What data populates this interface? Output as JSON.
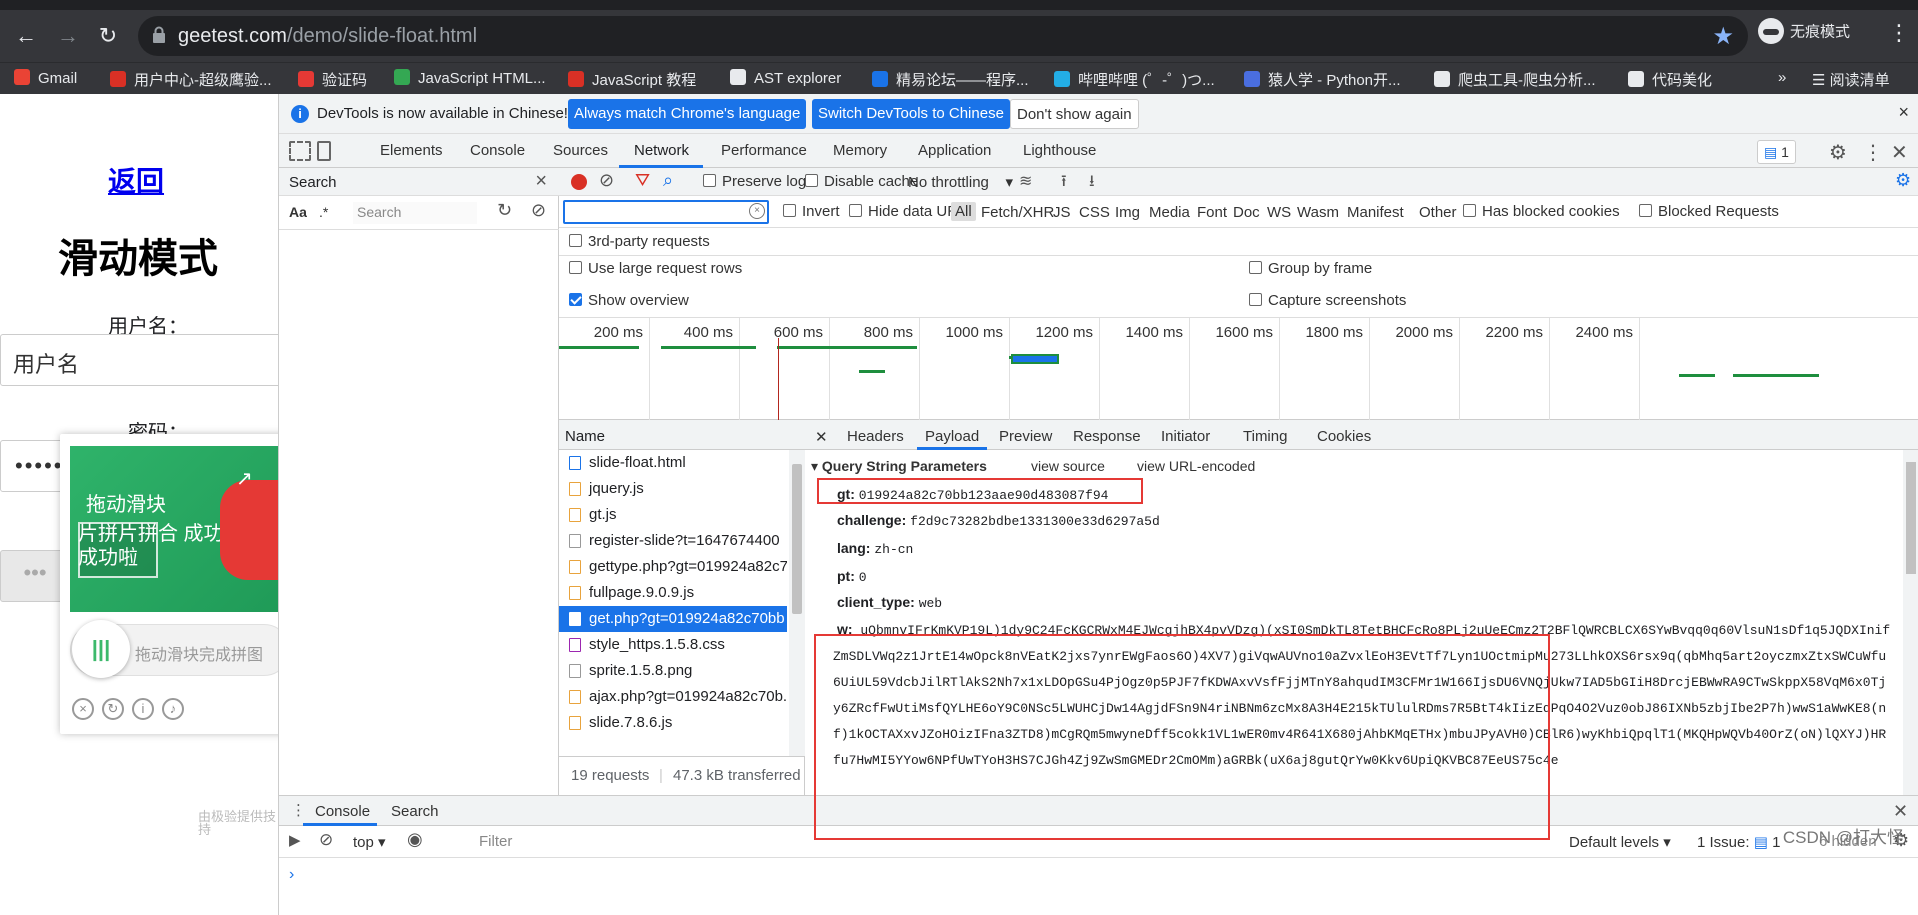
{
  "browser": {
    "url_host": "geetest.com",
    "url_path": "/demo/slide-float.html",
    "incognito_label": "无痕模式",
    "bookmarks": [
      {
        "label": "Gmail",
        "color": "#ea4335"
      },
      {
        "label": "用户中心-超级鹰验...",
        "color": "#d93025"
      },
      {
        "label": "验证码",
        "color": "#e53935"
      },
      {
        "label": "JavaScript HTML...",
        "color": "#34a853"
      },
      {
        "label": "JavaScript 教程",
        "color": "#d93025"
      },
      {
        "label": "AST explorer",
        "color": "#e8eaed"
      },
      {
        "label": "精易论坛——程序...",
        "color": "#1a73e8"
      },
      {
        "label": "哔哩哔哩 (゜-゜)つ...",
        "color": "#23ade5"
      },
      {
        "label": "猿人学 - Python开...",
        "color": "#4a6ee0"
      },
      {
        "label": "爬虫工具-爬虫分析...",
        "color": "#e8eaed"
      },
      {
        "label": "代码美化",
        "color": "#e8eaed"
      }
    ],
    "more_label": "»",
    "reading_list": "阅读清单"
  },
  "page": {
    "back_link": "返回",
    "title": "滑动模式",
    "username_label": "用户名：",
    "username_value": "用户名",
    "password_label": "密码：",
    "password_value": "••••••",
    "button_dots": "•••",
    "captcha": {
      "hint_line1": "拖动滑块",
      "hint_line2": "片拼片拼合 成功 成功啦",
      "slider_text": "拖动滑块完成拼图",
      "footer": "由极验提供技持"
    }
  },
  "devtools": {
    "info_message": "DevTools is now available in Chinese!",
    "btn_match": "Always match Chrome's language",
    "btn_switch": "Switch DevTools to Chinese",
    "btn_dont_show": "Don't show again",
    "panels": [
      "Elements",
      "Console",
      "Sources",
      "Network",
      "Performance",
      "Memory",
      "Application",
      "Lighthouse"
    ],
    "messages_count": "1",
    "search_title": "Search",
    "search_aa": "Aa",
    "search_regex": ".*",
    "search_placeholder": "Search",
    "network": {
      "preserve_log": "Preserve log",
      "disable_cache": "Disable cache",
      "throttling": "No throttling",
      "invert": "Invert",
      "hide_data_urls": "Hide data URLs",
      "types": [
        "All",
        "Fetch/XHR",
        "JS",
        "CSS",
        "Img",
        "Media",
        "Font",
        "Doc",
        "WS",
        "Wasm",
        "Manifest",
        "Other"
      ],
      "has_blocked_cookies": "Has blocked cookies",
      "blocked_requests": "Blocked Requests",
      "third_party": "3rd-party requests",
      "large_rows": "Use large request rows",
      "group_by_frame": "Group by frame",
      "show_overview": "Show overview",
      "capture_screenshots": "Capture screenshots",
      "timeline_ticks": [
        "200 ms",
        "400 ms",
        "600 ms",
        "800 ms",
        "1000 ms",
        "1200 ms",
        "1400 ms",
        "1600 ms",
        "1800 ms",
        "2000 ms",
        "2200 ms",
        "2400 ms"
      ],
      "name_header": "Name",
      "requests": [
        {
          "name": "slide-float.html",
          "type": "doc"
        },
        {
          "name": "jquery.js",
          "type": "js"
        },
        {
          "name": "gt.js",
          "type": "js"
        },
        {
          "name": "register-slide?t=1647674400",
          "type": "img"
        },
        {
          "name": "gettype.php?gt=019924a82c7",
          "type": "js"
        },
        {
          "name": "fullpage.9.0.9.js",
          "type": "js"
        },
        {
          "name": "get.php?gt=019924a82c70bb",
          "type": "js",
          "selected": true
        },
        {
          "name": "style_https.1.5.8.css",
          "type": "css"
        },
        {
          "name": "sprite.1.5.8.png",
          "type": "img"
        },
        {
          "name": "ajax.php?gt=019924a82c70b.",
          "type": "js"
        },
        {
          "name": "slide.7.8.6.js",
          "type": "js"
        }
      ],
      "footer_requests": "19 requests",
      "footer_transferred": "47.3 kB transferred",
      "detail_tabs": [
        "Headers",
        "Payload",
        "Preview",
        "Response",
        "Initiator",
        "Timing",
        "Cookies"
      ],
      "qsp_title": "Query String Parameters",
      "view_source": "view source",
      "view_url_encoded": "view URL-encoded",
      "params": {
        "gt": "019924a82c70bb123aae90d483087f94",
        "challenge": "f2d9c73282bdbe1331300e33d6297a5d",
        "lang": "zh-cn",
        "pt": "0",
        "client_type": "web",
        "w": "uQbmnvIFrKmKVP19L)1dy9C24FcKGCRWxM4EJWcgjhBX4pvVDzg)(xSI0SmDkTL8TetBHCFcRo8PLj2uUeECmz2T2BFlQWRCBLCX6SYwBvqq0q60VlsuN1sDf1q5JQDXInifZmSDLVWq2z1JrtE14wOpck8nVEatK2jxs7ynrEWgFaos6O)4XV7)giVqwAUVno10aZvxlEoH3EVtTf7Lyn1UOctmipMu273LLhkOXS6rsx9q(qbMhq5art2oyczmxZtxSWCuWfu6UiUL59VdcbJilRTlAkS2Nh7x1xLDOpGSu4PjOgz0p5PJF7fKDWAxvVsfFjjMTnY8ahqudIM3CFMr1W166IjsDU6VNQjUkw7IAD5bGIiH8DrcjEBWwRA9CTwSkppX58VqM6x0Tjy6ZRcfFwUtiMsfQYLHE6oY9C0NSc5LWUHCjDw14AgjdFSn9N4riNBNm6zcMx8A3H4E215kTUlulRDms7R5BtT4kIizEqPqO4O2Vuz0obJ86IXNb5zbjIbe2P7h)wwS1aWwKE8(nf)1kOCTAXxvJZoHOizIFna3ZTD8)mCgRQm5mwyneDff5cokk1VL1wER0mv4R641X680jAhbKMqETHx)mbuJPyAVH0)CBlR6)wyKhbiQpqlT1(MKQHpWQVb40OrZ(oN)lQXYJ)HRfu7HwMI5YYow6NPfUwTYoH3HS7CJGh4Zj9ZwSmGMEDr2CmOMm)aGRBk(uX6aj8gutQrYw0Kkv6UpiQKVBC87EeUS75c4e"
      }
    },
    "drawer_tabs": [
      "Console",
      "Search"
    ],
    "context": "top",
    "filter_placeholder": "Filter",
    "default_levels": "Default levels",
    "issues": "1 Issue:",
    "issues_count": "1",
    "hidden": "6 hidden",
    "prompt": "›"
  },
  "watermark": "CSDN @打大怪"
}
